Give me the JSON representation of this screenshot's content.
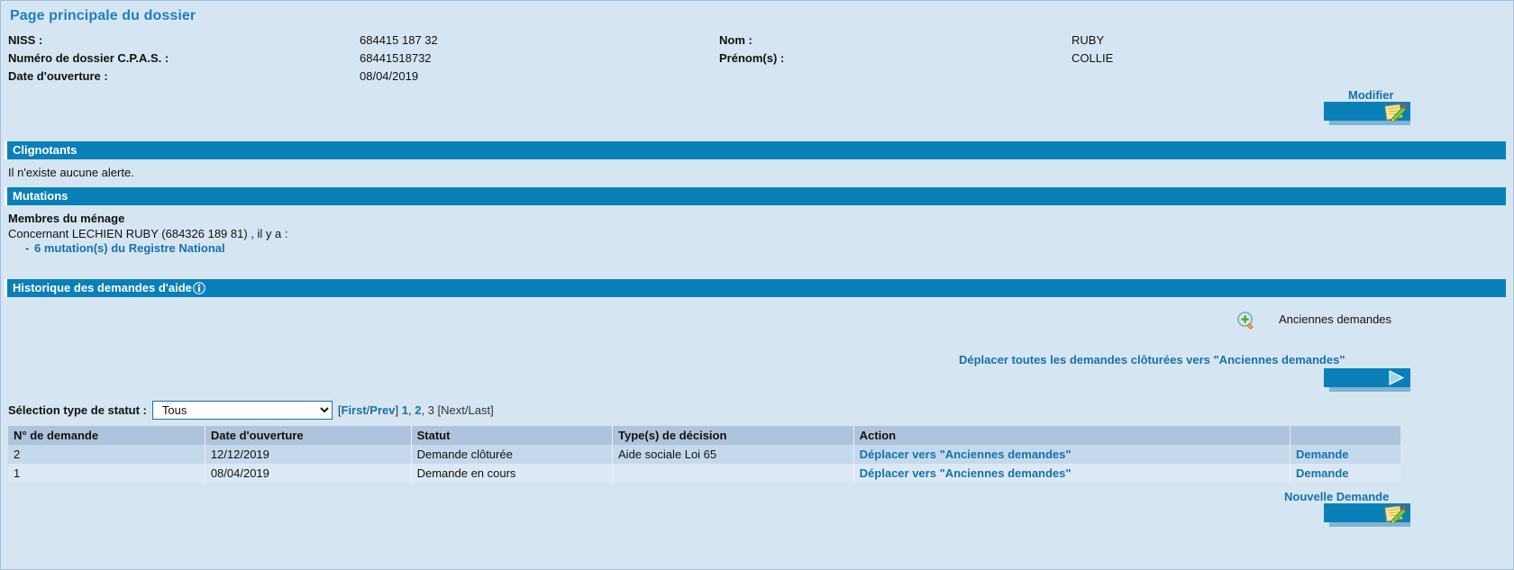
{
  "page": {
    "title": "Page principale du dossier"
  },
  "identity": {
    "left": [
      {
        "label": "NISS :",
        "value": "684415 187 32"
      },
      {
        "label": "Numéro de dossier C.P.A.S. :",
        "value": "68441518732"
      },
      {
        "label": "Date d'ouverture :",
        "value": "08/04/2019"
      }
    ],
    "right": [
      {
        "label": "Nom :",
        "value": "RUBY"
      },
      {
        "label": "Prénom(s) :",
        "value": "COLLIE"
      }
    ]
  },
  "modify_button": {
    "label": "Modifier",
    "icon": "notepad-pencil-icon"
  },
  "sections": {
    "clignotants": {
      "title": "Clignotants",
      "body": "Il n'existe aucune alerte."
    },
    "mutations": {
      "title": "Mutations",
      "heading": "Membres du ménage",
      "line": "Concernant LECHIEN RUBY (684326 189 81) , il y a :",
      "bullet": "-",
      "link": "6 mutation(s) du Registre National"
    },
    "historique": {
      "title": "Historique des demandes d'aide",
      "info_icon": "info-icon"
    }
  },
  "old_requests": {
    "icon": "magnifier-plus-icon",
    "label": "Anciennes demandes"
  },
  "move_all": {
    "link": "Déplacer toutes les demandes clôturées vers \"Anciennes demandes\"",
    "icon": "play-arrow-icon"
  },
  "filter": {
    "label": "Sélection type de statut :",
    "selected": "Tous",
    "options": [
      "Tous"
    ]
  },
  "pager": {
    "first_prev_open": "[",
    "first": "First",
    "slash": "/",
    "prev": "Prev",
    "first_prev_close": "]",
    "pages": [
      {
        "label": "1",
        "current": false
      },
      {
        "label": "2",
        "current": false
      },
      {
        "label": "3",
        "current": true
      }
    ],
    "separator": ", ",
    "next_last": "[Next/Last]"
  },
  "table": {
    "headers": [
      "N° de demande",
      "Date d'ouverture",
      "Statut",
      "Type(s) de décision",
      "Action",
      ""
    ],
    "rows": [
      {
        "num": "2",
        "date": "12/12/2019",
        "statut": "Demande clôturée",
        "type": "Aide sociale Loi 65",
        "action": "Déplacer vers \"Anciennes demandes\"",
        "demande": "Demande"
      },
      {
        "num": "1",
        "date": "08/04/2019",
        "statut": "Demande en cours",
        "type": "",
        "action": "Déplacer vers \"Anciennes demandes\"",
        "demande": "Demande"
      }
    ]
  },
  "new_request": {
    "label": "Nouvelle Demande",
    "icon": "notepad-pencil-icon"
  },
  "colors": {
    "page_background": "#d6e5f2",
    "section_bar": "#0a80b9",
    "link": "#1572ab",
    "title": "#1f7fbf",
    "table_header": "#aec4dc",
    "row_odd": "#c5d9ec",
    "row_even": "#dce9f5"
  }
}
